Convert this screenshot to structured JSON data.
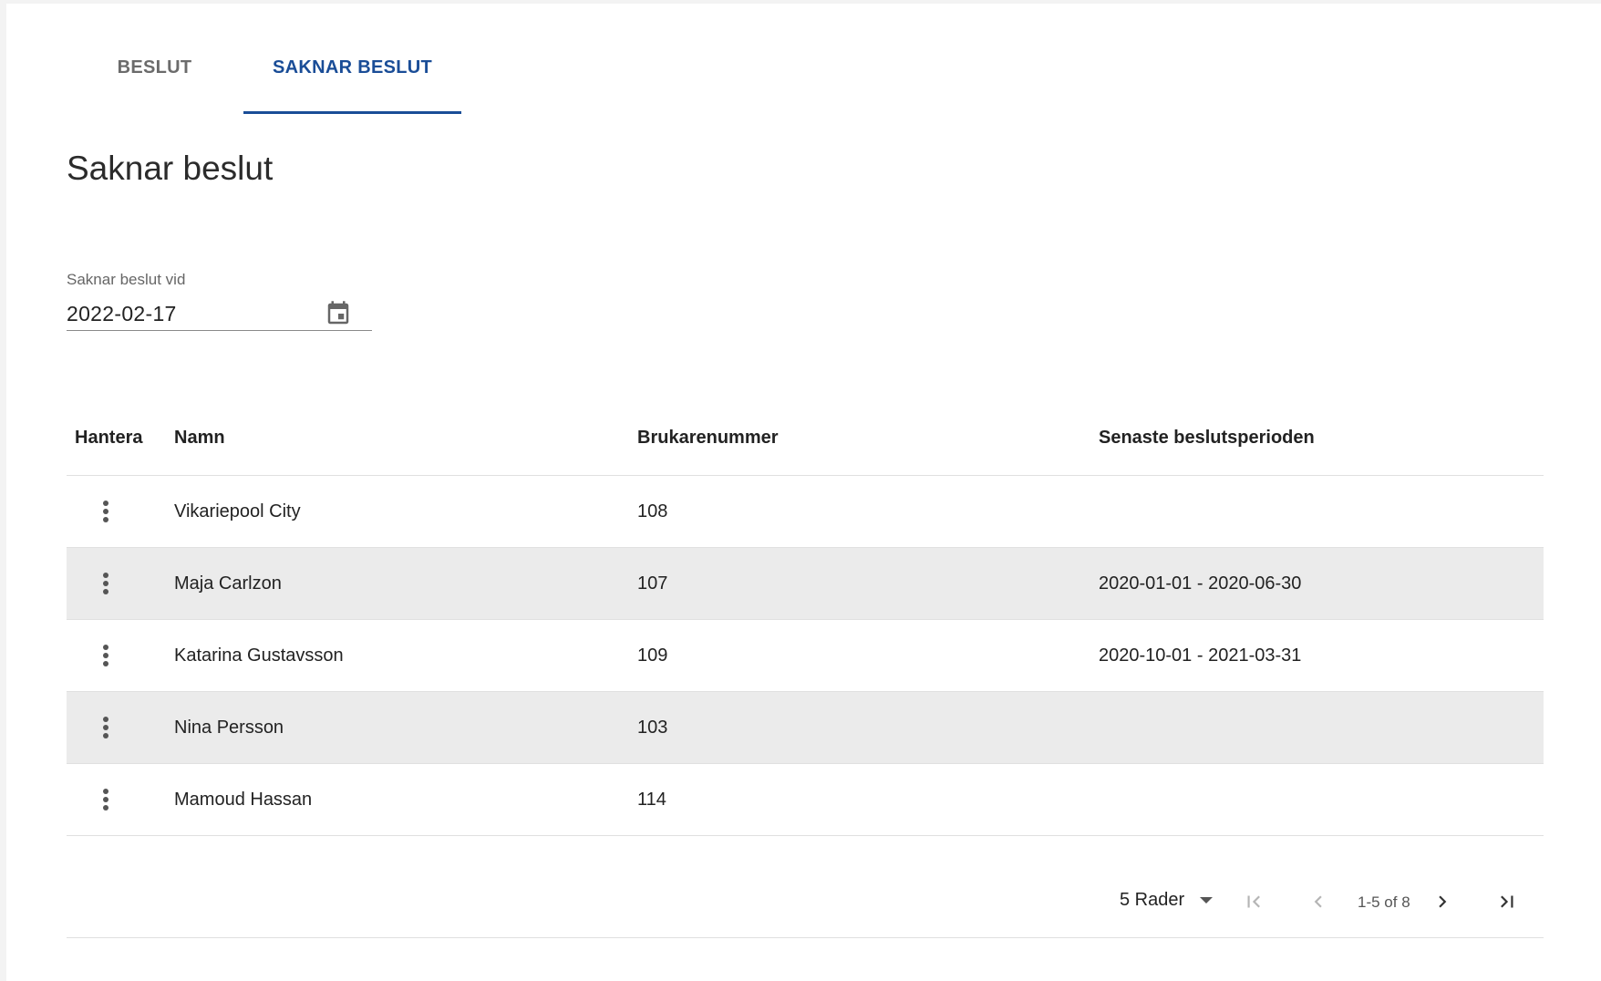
{
  "tabs": [
    {
      "label": "BESLUT",
      "active": false
    },
    {
      "label": "SAKNAR BESLUT",
      "active": true
    }
  ],
  "page_title": "Saknar beslut",
  "date_filter": {
    "label": "Saknar beslut vid",
    "value": "2022-02-17",
    "icon": "calendar-icon"
  },
  "table": {
    "columns": [
      "Hantera",
      "Namn",
      "Brukarenummer",
      "Senaste beslutsperioden"
    ],
    "rows": [
      {
        "name": "Vikariepool City",
        "number": "108",
        "period": ""
      },
      {
        "name": "Maja Carlzon",
        "number": "107",
        "period": "2020-01-01 - 2020-06-30"
      },
      {
        "name": "Katarina Gustavsson",
        "number": "109",
        "period": "2020-10-01 - 2021-03-31"
      },
      {
        "name": "Nina Persson",
        "number": "103",
        "period": ""
      },
      {
        "name": "Mamoud Hassan",
        "number": "114",
        "period": ""
      }
    ]
  },
  "pagination": {
    "rows_per_page": "5 Rader",
    "range_text": "1-5 of 8",
    "icons": [
      "first-page-icon",
      "previous-page-icon",
      "next-page-icon",
      "last-page-icon"
    ]
  },
  "colors": {
    "accent": "#1a4d97",
    "row_shade": "#ebebeb"
  }
}
